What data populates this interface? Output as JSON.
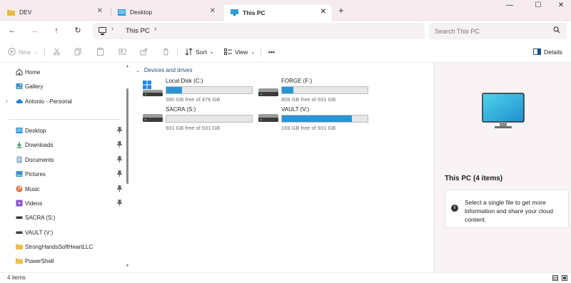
{
  "tabs": [
    {
      "label": "DEV",
      "active": false,
      "icon": "folder-icon"
    },
    {
      "label": "Desktop",
      "active": false,
      "icon": "desktop-icon"
    },
    {
      "label": "This PC",
      "active": true,
      "icon": "computer-icon"
    }
  ],
  "window_controls": {
    "minimize": "—",
    "maximize": "☐",
    "close": "✕"
  },
  "nav": {
    "back": "←",
    "forward": "→",
    "up": "↑",
    "refresh": "↻"
  },
  "address": {
    "path": "This PC",
    "separator": "›"
  },
  "search": {
    "placeholder": "Search This PC"
  },
  "toolbar": {
    "new_label": "New",
    "sort_label": "Sort",
    "view_label": "View",
    "more_label": "•••",
    "details_label": "Details"
  },
  "sidebar": {
    "top_items": [
      {
        "label": "Home",
        "icon": "home-icon"
      },
      {
        "label": "Gallery",
        "icon": "gallery-icon"
      },
      {
        "label": "Antonio - Personal",
        "icon": "cloud-icon"
      }
    ],
    "pinned_items": [
      {
        "label": "Desktop",
        "icon": "desktop-icon",
        "pinned": true
      },
      {
        "label": "Downloads",
        "icon": "download-icon",
        "pinned": true
      },
      {
        "label": "Documents",
        "icon": "documents-icon",
        "pinned": true
      },
      {
        "label": "Pictures",
        "icon": "pictures-icon",
        "pinned": true
      },
      {
        "label": "Music",
        "icon": "music-icon",
        "pinned": true
      },
      {
        "label": "Videos",
        "icon": "videos-icon",
        "pinned": true
      },
      {
        "label": "SACRA (S:)",
        "icon": "drive-icon",
        "pinned": false
      },
      {
        "label": "VAULT (V:)",
        "icon": "drive-icon",
        "pinned": false
      },
      {
        "label": "StrongHandsSoftHeartLLC",
        "icon": "folder-icon",
        "pinned": false
      },
      {
        "label": "PowerShell",
        "icon": "folder-icon",
        "pinned": false
      }
    ]
  },
  "main": {
    "group_label": "Devices and drives",
    "drives": [
      {
        "name": "Local Disk (C:)",
        "free_text": "390 GB free of 476 GB",
        "used_fraction": 0.18,
        "icon": "windows-drive-icon"
      },
      {
        "name": "FORGE (F:)",
        "free_text": "806 GB free of 931 GB",
        "used_fraction": 0.13,
        "icon": "drive-icon"
      },
      {
        "name": "SACRA (S:)",
        "free_text": "931 GB free of 931 GB",
        "used_fraction": 0.0,
        "icon": "drive-icon"
      },
      {
        "name": "VAULT (V:)",
        "free_text": "169 GB free of 931 GB",
        "used_fraction": 0.82,
        "icon": "drive-icon"
      }
    ]
  },
  "details_pane": {
    "title": "This PC (4 items)",
    "hint": "Select a single file to get more information and share your cloud content."
  },
  "status": {
    "count": "4 items"
  },
  "colors": {
    "accent": "#2795d6",
    "group_header": "#1f4e8c",
    "tab_strip": "#f6ecef"
  }
}
